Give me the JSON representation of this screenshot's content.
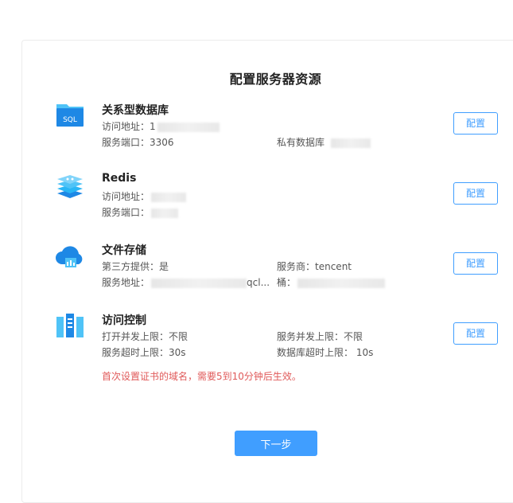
{
  "title": "配置服务器资源",
  "sections": [
    {
      "name": "关系型数据库",
      "icon": "sql-folder-icon",
      "lines": [
        {
          "label": "访问地址：",
          "value": "1"
        },
        {
          "label": "服务端口：",
          "value": "3306"
        },
        {
          "label": "私有数据库",
          "value": ""
        }
      ],
      "button": "配置"
    },
    {
      "name": "Redis",
      "icon": "redis-icon",
      "lines": [
        {
          "label": "访问地址：",
          "value": ""
        },
        {
          "label": "服务端口：",
          "value": ""
        }
      ],
      "button": "配置"
    },
    {
      "name": "文件存储",
      "icon": "cloud-storage-icon",
      "lines": [
        {
          "label": "第三方提供：",
          "value": "是"
        },
        {
          "label": "服务商：",
          "value": "tencent"
        },
        {
          "label": "服务地址：",
          "value": "qcl..."
        },
        {
          "label": "桶：",
          "value": ""
        }
      ],
      "button": "配置"
    },
    {
      "name": "访问控制",
      "icon": "server-rack-icon",
      "lines": [
        {
          "label": "打开并发上限：",
          "value": "不限"
        },
        {
          "label": "服务并发上限：",
          "value": "不限"
        },
        {
          "label": "服务超时上限：",
          "value": "30s"
        },
        {
          "label": "数据库超时上限：",
          "value": "10s"
        }
      ],
      "button": "配置"
    }
  ],
  "warning": "首次设置证书的域名，需要5到10分钟后生效。",
  "next_button": "下一步",
  "colors": {
    "accent": "#409eff",
    "warning": "#e05a5a"
  }
}
